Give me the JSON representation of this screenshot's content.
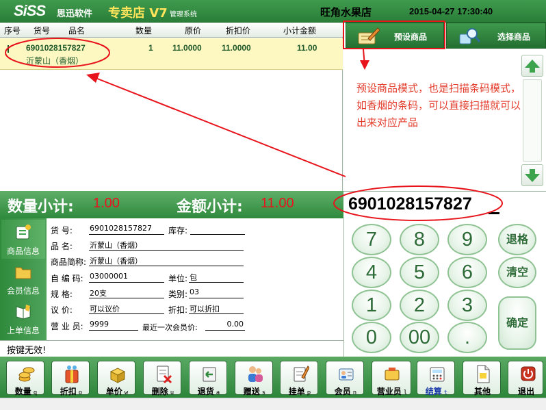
{
  "title_bar": {
    "logo_brand": "SiSS",
    "logo_company": "思迅软件",
    "logo_product": "专卖店 V7",
    "logo_subtitle": "管理系统",
    "store_name": "旺角水果店",
    "datetime": "2015-04-27 17:30:40"
  },
  "table": {
    "headers": [
      "序号",
      "货号",
      "品名",
      "数量",
      "原价",
      "折扣价",
      "小计金额"
    ],
    "rows": [
      {
        "code": "6901028157827",
        "name": "沂蒙山（香烟）",
        "qty": "1",
        "price": "11.0000",
        "discount_price": "11.0000",
        "subtotal": "11.00"
      }
    ]
  },
  "mode_buttons": {
    "preset": "预设商品",
    "select": "选择商品"
  },
  "summary": {
    "qty_label": "数量小计:",
    "qty_value": "1.00",
    "amount_label": "金额小计:",
    "amount_value": "11.00"
  },
  "barcode_input": {
    "value": "6901028157827"
  },
  "side_tabs": [
    "商品信息",
    "会员信息",
    "上单信息"
  ],
  "info": {
    "code_label": "货    号:",
    "code": "6901028157827",
    "stock_label": "库存:",
    "stock": "",
    "name_label": "品    名:",
    "name": "沂蒙山（香烟）",
    "short_label": "商品简称:",
    "short_name": "沂蒙山（香烟）",
    "selfcode_label": "自 编 码:",
    "selfcode": "03000001",
    "unit_label": "单位:",
    "unit": "包",
    "spec_label": "规    格:",
    "spec": "20支",
    "category_label": "类别:",
    "category": "03",
    "bargain_label": "议    价:",
    "bargain": "可以议价",
    "discount_label": "折扣:",
    "discount": "可以折扣",
    "clerk_label": "营 业 员:",
    "clerk": "9999",
    "member_price_label": "最近一次会员价:",
    "member_price": "0.00"
  },
  "status": {
    "message": "按键无效!"
  },
  "keypad": {
    "keys": [
      "7",
      "8",
      "9",
      "4",
      "5",
      "6",
      "1",
      "2",
      "3",
      "0",
      "00",
      "."
    ],
    "back": "退格",
    "clear": "清空",
    "enter": "确定"
  },
  "toolbar": [
    {
      "label": "数量",
      "key": "q",
      "icon": "coins-icon"
    },
    {
      "label": "折扣",
      "key": "o",
      "icon": "gift-bag-icon"
    },
    {
      "label": "单价",
      "key": "w",
      "icon": "price-box-icon"
    },
    {
      "label": "删除",
      "key": "u",
      "icon": "delete-doc-icon"
    },
    {
      "label": "退货",
      "key": "a",
      "icon": "return-icon"
    },
    {
      "label": "赠送",
      "key": "s",
      "icon": "people-icon"
    },
    {
      "label": "挂单",
      "key": "p",
      "icon": "hang-order-icon"
    },
    {
      "label": "会员",
      "key": "n",
      "icon": "member-card-icon"
    },
    {
      "label": "营业员",
      "key": "l",
      "icon": "clerk-icon"
    },
    {
      "label": "结算",
      "key": "t",
      "icon": "checkout-icon"
    },
    {
      "label": "其他",
      "key": "",
      "icon": "document-icon"
    },
    {
      "label": "退出",
      "key": "",
      "icon": "power-icon"
    }
  ],
  "annotation": {
    "text": "预设商品模式，也是扫描条码模式，如香烟的条码，可以直接扫描就可以出来对应产品"
  },
  "colors": {
    "accent_green": "#2f8a3c",
    "highlight_red": "#e8141c",
    "annotation_red": "#e33a2a",
    "selected_row": "#fdf7c2"
  }
}
